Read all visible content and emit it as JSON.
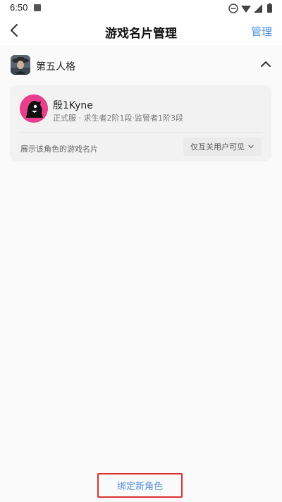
{
  "status_bar": {
    "time": "6:50"
  },
  "header": {
    "title": "游戏名片管理",
    "manage_label": "管理"
  },
  "game": {
    "name": "第五人格"
  },
  "character_card": {
    "name": "殷1Kyne",
    "detail": "正式服 · 求生者2阶1段·监管者1阶3段",
    "show_label": "展示该角色的游戏名片",
    "visibility_value": "仅互关用户可见"
  },
  "footer": {
    "bind_button_label": "绑定新角色"
  },
  "colors": {
    "accent": "#4a8fe0",
    "avatar_bg": "#e83e8c",
    "highlight_border": "#d93232"
  }
}
